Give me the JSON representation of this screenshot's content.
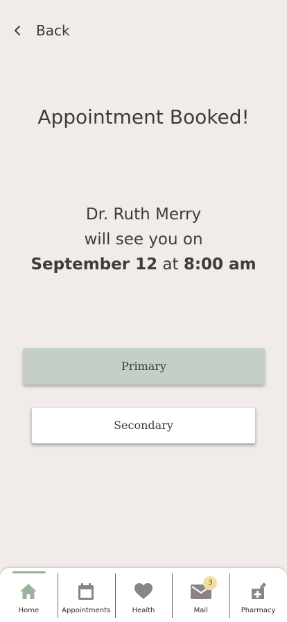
{
  "nav": {
    "back_label": "Back"
  },
  "confirmation": {
    "title": "Appointment Booked!",
    "doctor": "Dr. Ruth Merry",
    "line2": "will see you on",
    "date": "September 12",
    "at": "at",
    "time": "8:00 am"
  },
  "buttons": {
    "primary_label": "Primary",
    "secondary_label": "Secondary"
  },
  "tabbar": {
    "tabs": [
      {
        "label": "Home",
        "icon": "home-icon",
        "active": true
      },
      {
        "label": "Appointments",
        "icon": "calendar-icon",
        "active": false
      },
      {
        "label": "Health",
        "icon": "heart-icon",
        "active": false
      },
      {
        "label": "Mail",
        "icon": "mail-icon",
        "active": false,
        "badge": "3"
      },
      {
        "label": "Pharmacy",
        "icon": "pharmacy-icon",
        "active": false
      }
    ]
  },
  "colors": {
    "background": "#f1ecea",
    "text": "#3f3b39",
    "primary_button": "#c4cfc5",
    "active_tab": "#9db09d",
    "inactive_icon": "#8a8584",
    "badge": "#f2dea0"
  }
}
